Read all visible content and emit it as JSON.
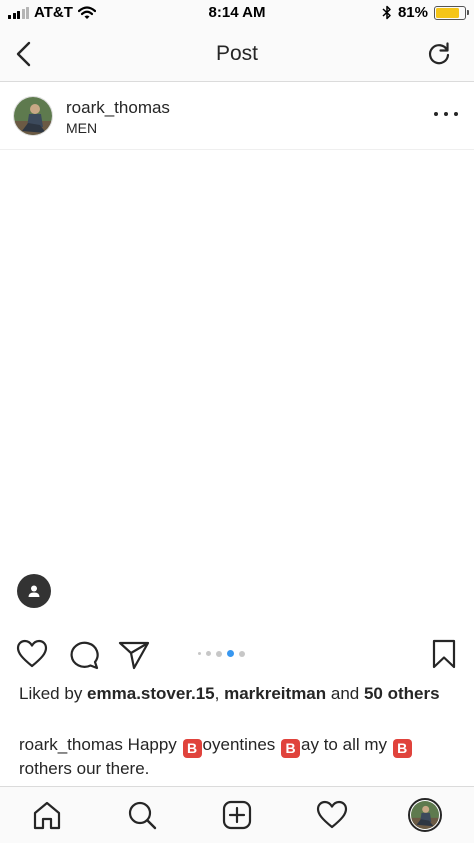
{
  "status_bar": {
    "carrier": "AT&T",
    "time": "8:14 AM",
    "battery_percent": "81%",
    "battery_level": 0.81,
    "battery_color": "#f5c518"
  },
  "nav": {
    "title": "Post",
    "back_icon": "chevron-left-icon",
    "refresh_icon": "refresh-icon"
  },
  "post": {
    "username": "roark_thomas",
    "location": "MEN",
    "carousel": {
      "total": 5,
      "active_index": 3,
      "active_color": "#3897f0"
    }
  },
  "likes": {
    "prefix": "Liked by ",
    "user1": "emma.stover.15",
    "separator": ", ",
    "user2": "markreitman",
    "middle": " and ",
    "others": "50 others"
  },
  "caption": {
    "username": "roark_thomas",
    "parts": [
      " Happy ",
      "oyentines ",
      "ay to all my ",
      "rothers our there."
    ],
    "emoji_glyph": "B"
  },
  "tab_bar": {
    "items": [
      "home-icon",
      "search-icon",
      "add-post-icon",
      "activity-heart-icon",
      "profile-avatar"
    ]
  }
}
